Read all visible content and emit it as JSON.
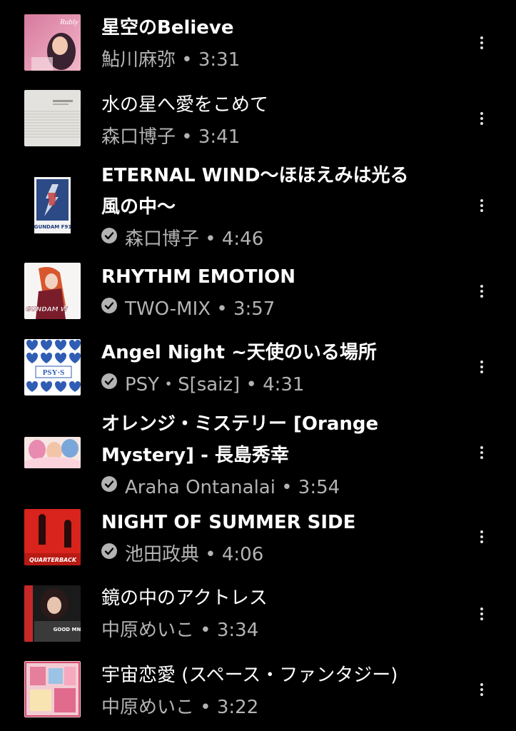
{
  "colors": {
    "background": "#000000",
    "title": "#ffffff",
    "subtitle": "#b3b3b3"
  },
  "tracks": [
    {
      "title_lines": [
        "星空のBelieve"
      ],
      "verified": false,
      "subtitle": "鮎川麻弥 • 3:31"
    },
    {
      "title_lines": [
        "水の星へ愛をこめて"
      ],
      "verified": false,
      "subtitle": "森口博子 • 3:41"
    },
    {
      "title_lines": [
        "ETERNAL WIND～ほほえみは光る",
        "風の中～"
      ],
      "verified": true,
      "subtitle": "森口博子 • 4:46"
    },
    {
      "title_lines": [
        "RHYTHM EMOTION"
      ],
      "verified": true,
      "subtitle": "TWO-MIX • 3:57"
    },
    {
      "title_lines": [
        "Angel Night ~天使のいる場所"
      ],
      "verified": true,
      "subtitle": "PSY・S[saiz] • 4:31"
    },
    {
      "title_lines": [
        "オレンジ・ミステリー [Orange",
        "Mystery] - 長島秀幸"
      ],
      "verified": true,
      "subtitle": "Araha Ontanalai • 3:54"
    },
    {
      "title_lines": [
        "NIGHT OF SUMMER SIDE"
      ],
      "verified": true,
      "subtitle": "池田政典 • 4:06"
    },
    {
      "title_lines": [
        "鏡の中のアクトレス"
      ],
      "verified": false,
      "subtitle": "中原めいこ • 3:34"
    },
    {
      "title_lines": [
        "宇宙恋愛 (スペース・ファンタジー)"
      ],
      "verified": false,
      "subtitle": "中原めいこ • 3:22"
    }
  ],
  "thumbnails": [
    {
      "album_text": "Rubly",
      "icon": "album-art-portrait"
    },
    {
      "album_text": "",
      "icon": "album-art-minimal"
    },
    {
      "album_text": "GUNDAM F91",
      "icon": "album-art-gundam-poster"
    },
    {
      "album_text": "GUNDAM W",
      "icon": "album-art-gundam-w"
    },
    {
      "album_text": "PSY·S",
      "icon": "album-art-hearts"
    },
    {
      "album_text": "",
      "icon": "album-art-anime"
    },
    {
      "album_text": "QUARTERBACK",
      "icon": "album-art-quarterback"
    },
    {
      "album_text": "GOOD MN",
      "icon": "album-art-collage"
    },
    {
      "album_text": "",
      "icon": "album-art-pink-collage"
    }
  ]
}
